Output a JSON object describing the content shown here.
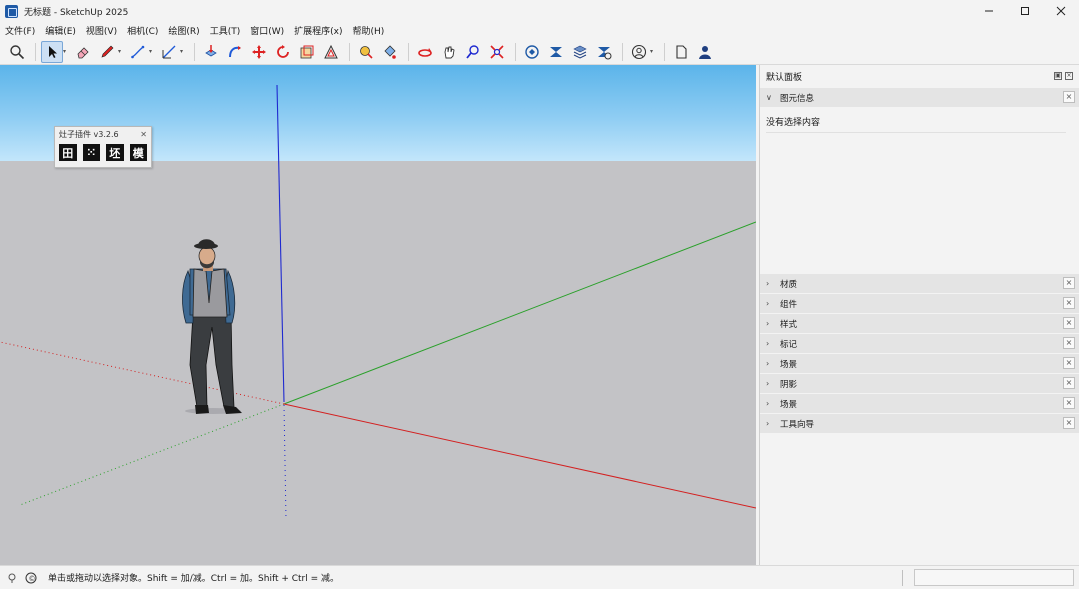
{
  "window": {
    "title": "无标题 - SketchUp 2025",
    "minimize_icon": "minimize-icon",
    "maximize_icon": "maximize-icon",
    "close_icon": "close-icon"
  },
  "menu": [
    {
      "label": "文件(F)"
    },
    {
      "label": "编辑(E)"
    },
    {
      "label": "视图(V)"
    },
    {
      "label": "相机(C)"
    },
    {
      "label": "绘图(R)"
    },
    {
      "label": "工具(T)"
    },
    {
      "label": "窗口(W)"
    },
    {
      "label": "扩展程序(x)"
    },
    {
      "label": "帮助(H)"
    }
  ],
  "toolbar": {
    "tools": [
      "search-icon",
      "select-icon",
      "eraser-icon",
      "pencil-icon",
      "line-icon",
      "rectangle-icon",
      "pushpull-icon",
      "followme-icon",
      "move-icon",
      "rotate-icon",
      "scale-icon",
      "offset-icon",
      "tapemeasure-icon",
      "paint-icon",
      "orbit-icon",
      "pan-icon",
      "zoom-icon",
      "zoom-extents-icon",
      "warehouse-icon",
      "extension-warehouse-icon",
      "layout-icon",
      "extension-manager-icon",
      "profile-icon",
      "new-model-icon",
      "account-icon"
    ],
    "active_tool": "select-icon"
  },
  "plugin": {
    "title": "灶子插件 v3.2.6",
    "buttons": [
      "田",
      "⁙",
      "坯",
      "模"
    ]
  },
  "tray": {
    "title": "默认面板",
    "entity_info": {
      "label": "图元信息",
      "content": "没有选择内容"
    },
    "panels": [
      {
        "label": "材质"
      },
      {
        "label": "组件"
      },
      {
        "label": "样式"
      },
      {
        "label": "标记"
      },
      {
        "label": "场景"
      },
      {
        "label": "阴影"
      },
      {
        "label": "场景"
      },
      {
        "label": "工具向导"
      }
    ]
  },
  "status": {
    "text": "单击或拖动以选择对象。Shift = 加/减。Ctrl = 加。Shift + Ctrl = 减。"
  },
  "colors": {
    "axis_red": "#d32020",
    "axis_green": "#2aa02a",
    "axis_blue": "#1f2ad0",
    "sky_top": "#5bb4ea",
    "ground": "#c3c3c6",
    "accent": "#cde0f4"
  }
}
